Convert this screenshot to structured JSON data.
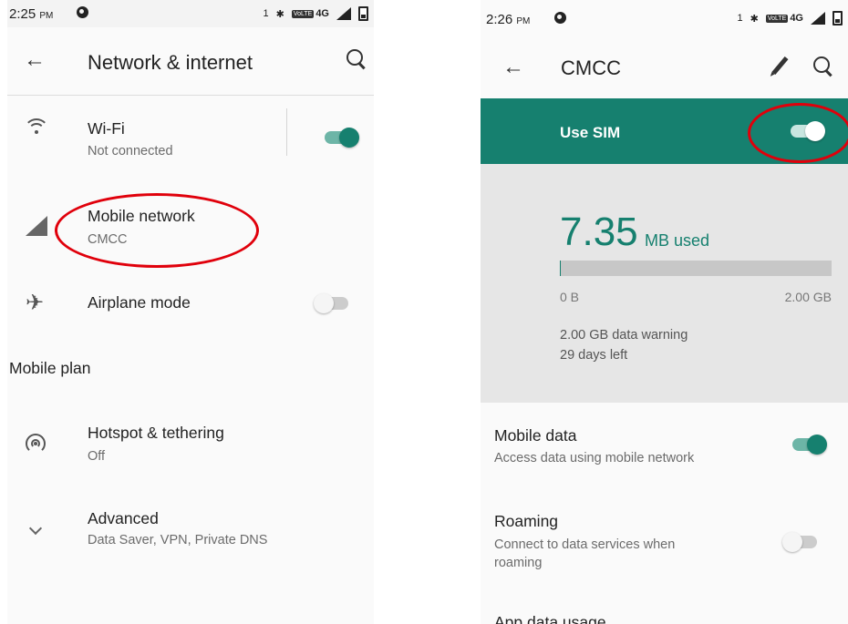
{
  "left": {
    "status": {
      "time": "2:25",
      "ampm": "PM",
      "sim": "1",
      "bt": "✱",
      "volte": "VoLTE",
      "net": "4G"
    },
    "appbar": {
      "back": "←",
      "title": "Network & internet"
    },
    "wifi": {
      "title": "Wi-Fi",
      "subtitle": "Not connected",
      "on": true
    },
    "mobile_network": {
      "title": "Mobile network",
      "subtitle": "CMCC"
    },
    "airplane": {
      "title": "Airplane mode",
      "on": false
    },
    "mobile_plan": {
      "title": "Mobile plan"
    },
    "hotspot": {
      "title": "Hotspot & tethering",
      "subtitle": "Off"
    },
    "advanced": {
      "title": "Advanced",
      "subtitle": "Data Saver, VPN, Private DNS"
    }
  },
  "right": {
    "status": {
      "time": "2:26",
      "ampm": "PM",
      "sim": "1",
      "bt": "✱",
      "volte": "VoLTE",
      "net": "4G"
    },
    "appbar": {
      "back": "←",
      "title": "CMCC"
    },
    "use_sim": {
      "label": "Use SIM",
      "on": true
    },
    "usage": {
      "amount": "7.35",
      "unit": "MB used",
      "fraction": 0.0036,
      "min": "0 B",
      "max": "2.00 GB",
      "warning": "2.00 GB data warning",
      "days_left": "29 days left"
    },
    "mobile_data": {
      "title": "Mobile data",
      "subtitle": "Access data using mobile network",
      "on": true
    },
    "roaming": {
      "title": "Roaming",
      "subtitle": "Connect to data services when roaming",
      "on": false
    },
    "app_data": {
      "title": "App data usage"
    }
  },
  "colors": {
    "accent": "#16806f",
    "highlight": "#e0000b"
  }
}
